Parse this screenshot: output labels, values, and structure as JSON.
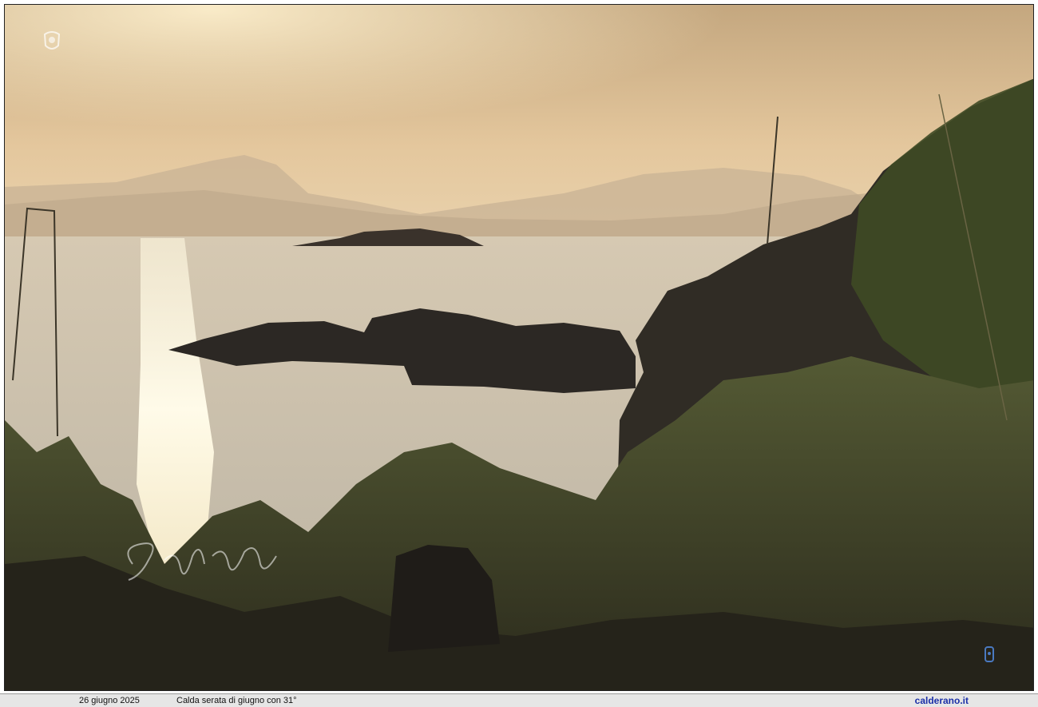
{
  "caption": {
    "date": "26 giugno  2025",
    "text": "Calda serata di giugno con 31°",
    "site": "calderano.it"
  },
  "watermark": {
    "signature_text": "Gigi Gallo",
    "crest_icon": "crest-icon",
    "corner_icon": "small-crest-icon"
  },
  "colors": {
    "sky_top": "#c8b08a",
    "sky_bottom": "#e8c9a0",
    "sea": "#c9bfae",
    "sun_glare": "#fff6d8",
    "rocks": "#2a2622",
    "vegetation": "#3d4226",
    "caption_bg": "#e6e6e6",
    "site_link": "#1a2fa8"
  }
}
